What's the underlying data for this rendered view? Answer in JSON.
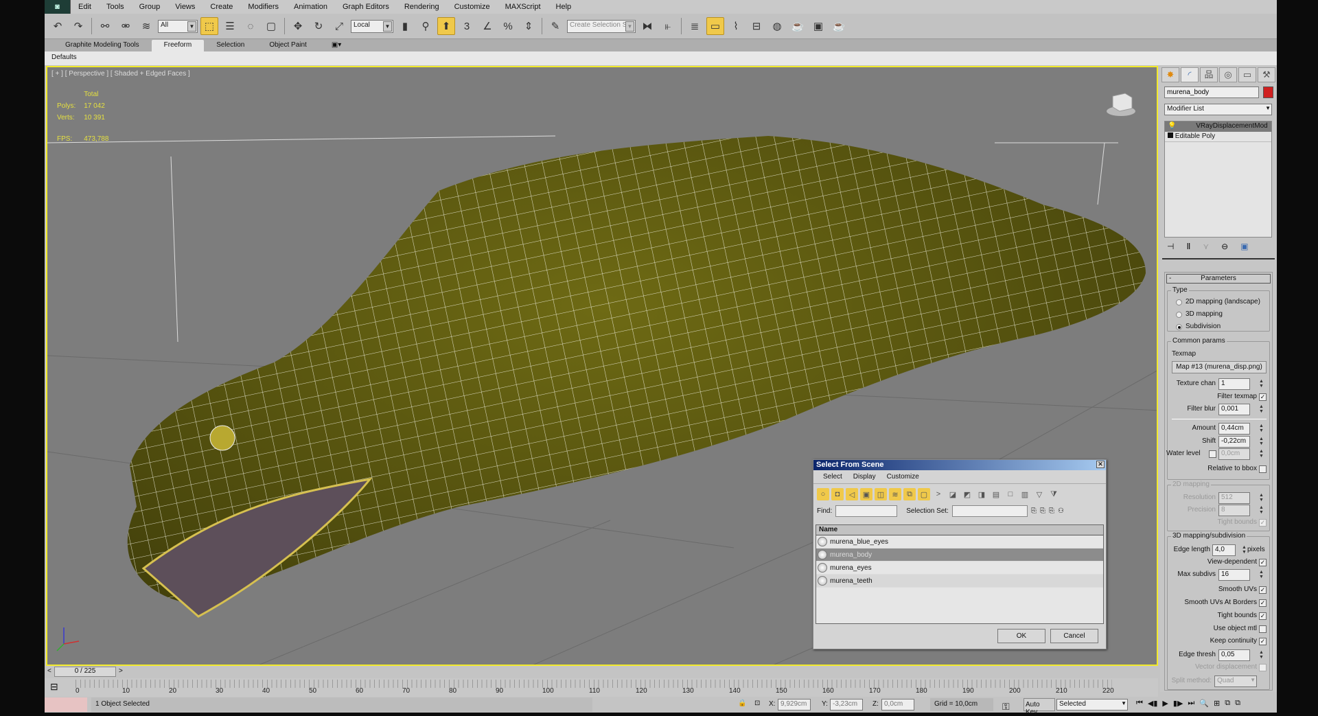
{
  "menu": [
    "Edit",
    "Tools",
    "Group",
    "Views",
    "Create",
    "Modifiers",
    "Animation",
    "Graph Editors",
    "Rendering",
    "Customize",
    "MAXScript",
    "Help"
  ],
  "toolbar": {
    "selection_filter": "All",
    "ref_coord": "Local",
    "named_selection_placeholder": "Create Selection Se"
  },
  "ribbon": {
    "tabs": [
      "Graphite Modeling Tools",
      "Freeform",
      "Selection",
      "Object Paint"
    ],
    "active": "Freeform",
    "sub": "Defaults"
  },
  "viewport": {
    "label": "[ + ] [ Perspective ] [ Shaded + Edged Faces ]",
    "stats": {
      "total_label": "Total",
      "polys_label": "Polys:",
      "polys": "17 042",
      "verts_label": "Verts:",
      "verts": "10 391",
      "fps_label": "FPS:",
      "fps": "473,788"
    }
  },
  "dialog": {
    "title": "Select From Scene",
    "menu": [
      "Select",
      "Display",
      "Customize"
    ],
    "find_label": "Find:",
    "find_value": "",
    "selset_label": "Selection Set:",
    "column": "Name",
    "items": [
      "murena_blue_eyes",
      "murena_body",
      "murena_eyes",
      "murena_teeth"
    ],
    "selected": 1,
    "ok": "OK",
    "cancel": "Cancel"
  },
  "cmd": {
    "object_name": "murena_body",
    "object_color": "#d02020",
    "modifier_list": "Modifier List",
    "stack": [
      "VRayDisplacementMod",
      "Editable Poly"
    ],
    "rollout": "Parameters",
    "type_group": "Type",
    "type_options": [
      "2D mapping (landscape)",
      "3D mapping",
      "Subdivision"
    ],
    "type_selected": 2,
    "common_group": "Common params",
    "texmap_label": "Texmap",
    "texmap": "Map #13 (murena_disp.png)",
    "texture_chan_label": "Texture chan",
    "texture_chan": "1",
    "filter_texmap_label": "Filter texmap",
    "filter_blur_label": "Filter blur",
    "filter_blur": "0,001",
    "amount_label": "Amount",
    "amount": "0,44cm",
    "shift_label": "Shift",
    "shift": "-0,22cm",
    "water_label": "Water level",
    "water": "0,0cm",
    "relative_label": "Relative to bbox",
    "map2d_group": "2D mapping",
    "resolution_label": "Resolution",
    "resolution": "512",
    "precision_label": "Precision",
    "precision": "8",
    "tight2d_label": "Tight bounds",
    "map3d_group": "3D mapping/subdivision",
    "edge_len_label": "Edge length",
    "edge_len": "4,0",
    "pixels_label": "pixels",
    "view_dep_label": "View-dependent",
    "max_subdivs_label": "Max subdivs",
    "max_subdivs": "16",
    "smooth_uvs_label": "Smooth UVs",
    "smooth_borders_label": "Smooth UVs At Borders",
    "tight_label": "Tight bounds",
    "use_mtl_label": "Use object mtl",
    "keep_cont_label": "Keep continuity",
    "edge_thresh_label": "Edge thresh",
    "edge_thresh": "0,05",
    "vector_label": "Vector displacement",
    "split_label": "Split method:",
    "split": "Quad"
  },
  "timeline": {
    "frame": "0 / 225",
    "ticks": [
      "0",
      "10",
      "20",
      "30",
      "40",
      "50",
      "60",
      "70",
      "80",
      "90",
      "100",
      "110",
      "120",
      "130",
      "140",
      "150",
      "160",
      "170",
      "180",
      "190",
      "200",
      "210",
      "220"
    ]
  },
  "status": {
    "message": "1 Object Selected",
    "x_label": "X:",
    "x": "9,929cm",
    "y_label": "Y:",
    "y": "-3,23cm",
    "z_label": "Z:",
    "z": "0,0cm",
    "grid": "Grid = 10,0cm",
    "auto_key": "Auto Key",
    "key_mode": "Selected"
  },
  "colors": {
    "accent": "#f0c94a",
    "viewport_border": "#f2ea2a",
    "stats": "#e5e040"
  }
}
